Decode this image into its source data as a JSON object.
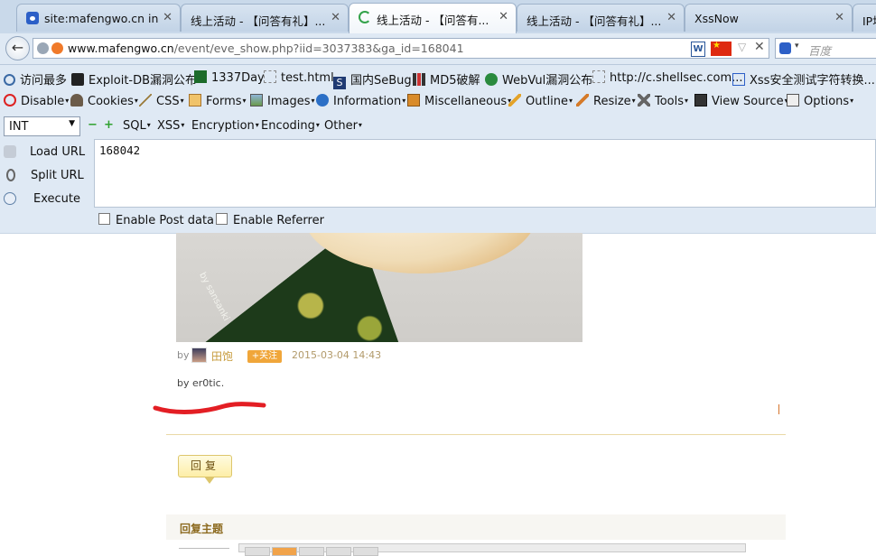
{
  "tabs": [
    {
      "title": "site:mafengwo.cn in...",
      "active": false,
      "icon": "paw-icon"
    },
    {
      "title": "线上活动 - 【问答有礼】...",
      "active": false
    },
    {
      "title": "线上活动 - 【问答有...",
      "active": true,
      "icon": "loading-spinner-icon"
    },
    {
      "title": "线上活动 - 【问答有礼】...",
      "active": false
    },
    {
      "title": "XssNow",
      "active": false
    },
    {
      "title": "IP地",
      "active": false
    }
  ],
  "close_glyph": "✕",
  "nav": {
    "url_host": "www.mafengwo.cn",
    "url_path": "/event/eve_show.php?iid=3037383&ga_id=168041",
    "search_placeholder": "百度"
  },
  "bookmarks": [
    {
      "label": "访问最多",
      "icon": "search-icon"
    },
    {
      "label": "Exploit-DB漏洞公布",
      "icon": "exploit-db-icon"
    },
    {
      "label": "1337Day",
      "icon": "1337day-icon"
    },
    {
      "label": "test.html",
      "icon": "page-icon"
    },
    {
      "label": "国内SeBug",
      "icon": "sebug-icon"
    },
    {
      "label": "MD5破解",
      "icon": "grid-icon"
    },
    {
      "label": "WebVul漏洞公布",
      "icon": "bug-icon"
    },
    {
      "label": "http://c.shellsec.com...",
      "icon": "page-icon"
    },
    {
      "label": "Xss安全测试字符转换...",
      "icon": "paw-icon"
    }
  ],
  "webdev_toolbar": [
    {
      "label": "Disable",
      "icon": "disable-icon"
    },
    {
      "label": "Cookies",
      "icon": "cookies-icon"
    },
    {
      "label": "CSS",
      "icon": "css-icon"
    },
    {
      "label": "Forms",
      "icon": "forms-icon"
    },
    {
      "label": "Images",
      "icon": "images-icon"
    },
    {
      "label": "Information",
      "icon": "info-icon"
    },
    {
      "label": "Miscellaneous",
      "icon": "misc-icon"
    },
    {
      "label": "Outline",
      "icon": "outline-icon"
    },
    {
      "label": "Resize",
      "icon": "resize-icon"
    },
    {
      "label": "Tools",
      "icon": "tools-icon"
    },
    {
      "label": "View Source",
      "icon": "view-source-icon"
    },
    {
      "label": "Options",
      "icon": "options-icon"
    }
  ],
  "hackbar": {
    "type_select": "INT",
    "decrease": "−",
    "increase": "+",
    "menus": [
      "SQL",
      "XSS",
      "Encryption",
      "Encoding",
      "Other"
    ],
    "buttons": {
      "load": "Load URL",
      "split": "Split URL",
      "execute": "Execute"
    },
    "textarea_value": "168042",
    "options": {
      "post": "Enable Post data",
      "referrer": "Enable Referrer"
    }
  },
  "post": {
    "watermark": "by sansanki",
    "by_prefix": "by",
    "author": "田饱",
    "follow": "+关注",
    "timestamp": "2015-03-04 14:43",
    "comment": "by er0tic."
  },
  "reply": {
    "button": "回复",
    "section_title": "回复主题"
  },
  "colors": {
    "chrome_bg": "#dfe9f4",
    "accent_orange": "#f0a63a",
    "annotation_red": "#e31e24",
    "title_brown": "#8c6a1f"
  }
}
